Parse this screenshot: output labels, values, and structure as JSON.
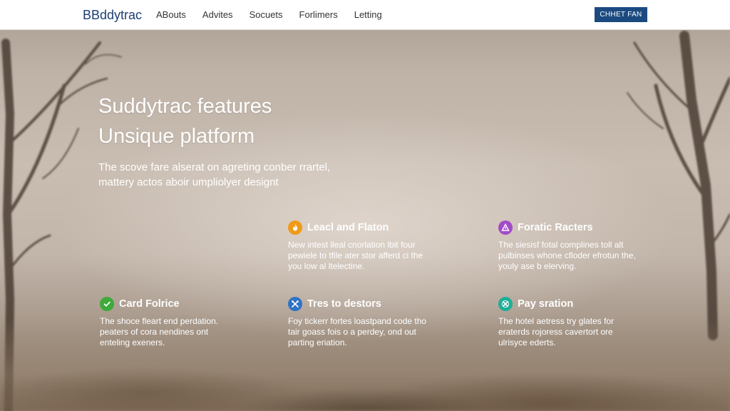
{
  "brand": "BBddytrac",
  "nav": {
    "links": [
      "ABouts",
      "Advites",
      "Socuets",
      "Forlimers",
      "Letting"
    ],
    "cta": "CHHET FAN"
  },
  "hero": {
    "title_line1": "Suddytrac features",
    "title_line2": "Unsique platform",
    "subtitle_line1": "The scove fare alserat on agreting conber rrartel,",
    "subtitle_line2": "mattery actos aboir umpliolyer designt"
  },
  "features": [
    {
      "title": "Leacl and Flaton",
      "icon": "flame-icon",
      "icon_color": "#f09a1a",
      "lines": [
        "New intest lleal cnorlation lbit four",
        "pewiele to tfile ater stor afferd ci the",
        "you low al ltelectine."
      ]
    },
    {
      "title": "Foratic Racters",
      "icon": "triangle-icon",
      "icon_color": "#a24cc8",
      "lines": [
        "The siesisf fotal complines toll alt",
        "pulbinses whone cfloder efrotun the,",
        "youly ase b elerving."
      ]
    },
    {
      "title": "Card Folrice",
      "icon": "check-icon",
      "icon_color": "#3daa3a",
      "lines": [
        "The shoce fleart end perdation.",
        "peaters of cora nendines ont",
        "enteling exeners."
      ]
    },
    {
      "title": "Tres to destors",
      "icon": "tools-icon",
      "icon_color": "#2f73c7",
      "lines": [
        "Foy tickerr fortes loastpand code tho",
        "tair goass fois o a perdey, ond out",
        "parting eriation."
      ]
    },
    {
      "title": "Pay sration",
      "icon": "cross-icon",
      "icon_color": "#1fae98",
      "lines": [
        "The hotel aetress try glates for",
        "eraterds rojoress cavertort ore",
        "ulrisyce ederts."
      ]
    }
  ]
}
